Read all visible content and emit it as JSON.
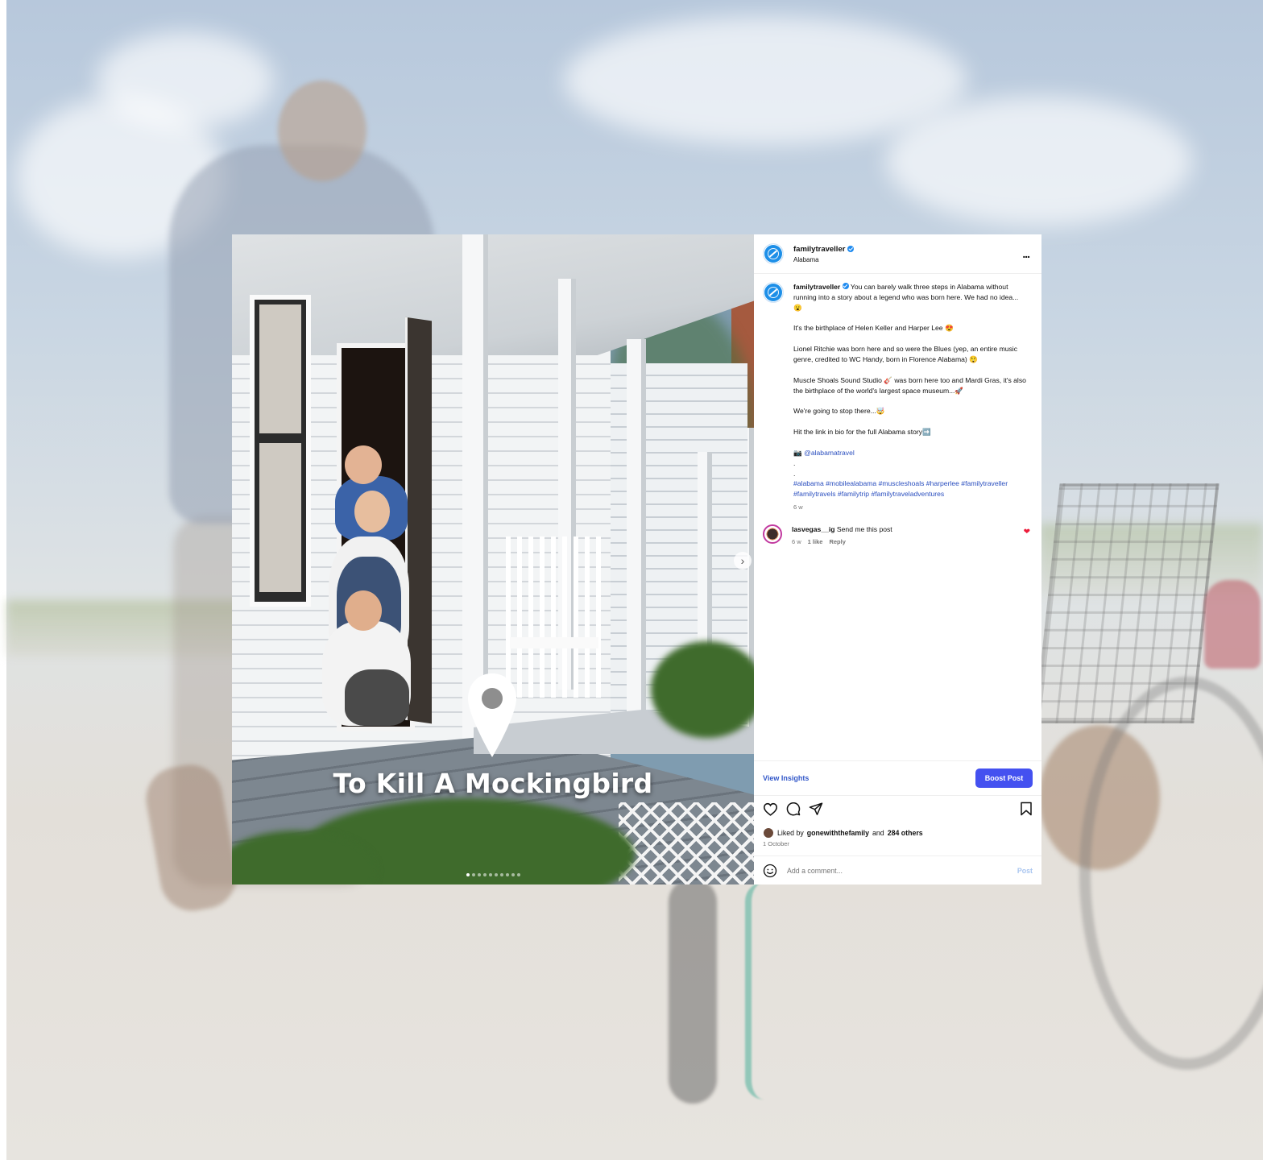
{
  "post": {
    "overlay_title": "To Kill A Mockingbird",
    "carousel_total": 10,
    "carousel_active": 1
  },
  "header": {
    "username": "familytraveller",
    "location": "Alabama",
    "more_label": "..."
  },
  "caption": {
    "username": "familytraveller",
    "first": "You can barely walk three steps in Alabama without running into a story about a legend who was born here. We had no idea...😮",
    "p2": "It's the birthplace of Helen Keller and Harper Lee 😍",
    "p3": "Lionel Ritchie was born here and so were the Blues (yep, an entire music genre, credited to WC Handy, born in Florence Alabama) 😲",
    "p4": "Muscle Shoals Sound Studio 🎸 was born here too and Mardi Gras, it's also the birthplace of the world's largest space museum...🚀",
    "p5": "We're going to stop there...🤯",
    "p6": "Hit the link in bio for the full Alabama story➡️",
    "credit_icon": "📷",
    "credit": "@alabamatravel",
    "dot1": ".",
    "dot2": ".",
    "hashtags": "#alabama #mobilealabama #muscleshoals #harperlee #familytraveller #familytravels #familytrip #familytraveladventures",
    "age": "6 w"
  },
  "comment": {
    "username": "lasvegas__ig",
    "text": "Send me this post",
    "age": "6 w",
    "likes": "1 like",
    "reply": "Reply"
  },
  "insights": {
    "view": "View Insights",
    "boost": "Boost Post"
  },
  "likes": {
    "prefix": "Liked by",
    "user": "gonewiththefamily",
    "and": "and",
    "others": "284 others"
  },
  "date": "1 October",
  "composer": {
    "placeholder": "Add a comment...",
    "post": "Post"
  },
  "icons": {
    "like": "heart-icon",
    "comment": "comment-icon",
    "share": "share-icon",
    "save": "bookmark-icon",
    "emoji": "emoji-icon",
    "next": "chevron-right-icon",
    "location": "map-pin-icon"
  },
  "colors": {
    "accent": "#4451f0",
    "link": "#2b4fbf",
    "verified": "#1f8bf0",
    "heart": "#ed1c3a"
  }
}
